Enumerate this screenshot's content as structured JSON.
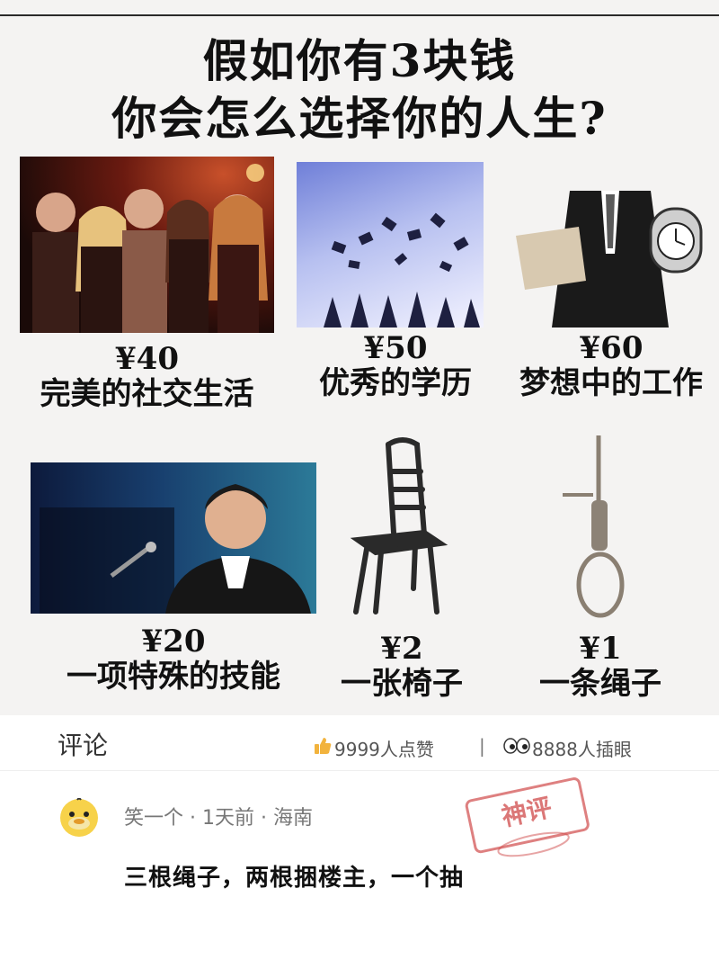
{
  "post": {
    "title_line1": "假如你有3块钱",
    "title_line2": "你会怎么选择你的人生?",
    "options": [
      {
        "price": "¥40",
        "label": "完美的社交生活"
      },
      {
        "price": "¥50",
        "label": "优秀的学历"
      },
      {
        "price": "¥60",
        "label": "梦想中的工作"
      },
      {
        "price": "¥20",
        "label": "一项特殊的技能"
      },
      {
        "price": "¥2",
        "label": "一张椅子"
      },
      {
        "price": "¥1",
        "label": "一条绳子"
      }
    ]
  },
  "comments_bar": {
    "title": "评论",
    "likes_icon": "thumbs-up-icon",
    "likes_text": "9999人点赞",
    "separator": "|",
    "views_icon": "eyes-icon",
    "views_text": "8888人插眼"
  },
  "comment": {
    "avatar_icon": "duck-avatar-icon",
    "meta": "笑一个 · 1天前 · 海南",
    "stamp_text": "神评",
    "stamp_icon": "god-comment-stamp",
    "text": "三根绳子，两根捆楼主，一个抽"
  }
}
